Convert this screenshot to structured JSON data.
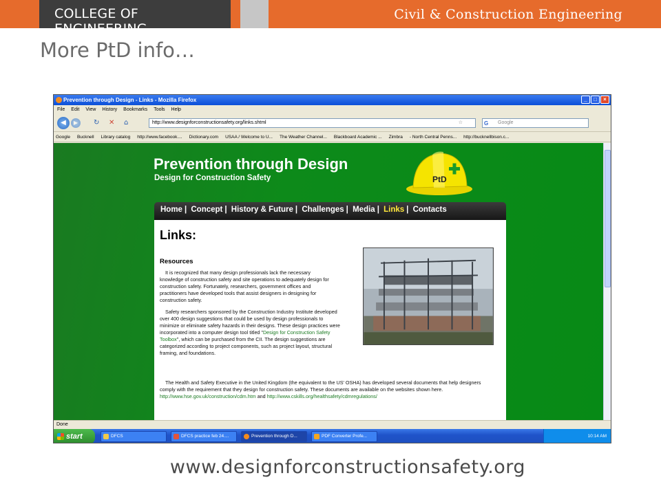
{
  "slide": {
    "banner_left": "COLLEGE OF ENGINEERING",
    "banner_right": "Civil & Construction Engineering",
    "title": "More PtD info…",
    "footer_url": "www.designforconstructionsafety.org"
  },
  "browser": {
    "window_title": "Prevention through Design - Links - Mozilla Firefox",
    "menu": [
      "File",
      "Edit",
      "View",
      "History",
      "Bookmarks",
      "Tools",
      "Help"
    ],
    "url": "http://www.designforconstructionsafety.org/links.shtml",
    "search_placeholder": "Google",
    "bookmarks": [
      "Google",
      "Bucknell",
      "Library catalog",
      "http://www.facebook....",
      "Dictionary.com",
      "USAA / Welcome to U...",
      "The Weather Channel...",
      "Blackboard Academic ...",
      "Zimbra",
      "- North Central Penns...",
      "http://bucknellbison.c..."
    ],
    "status": "Done"
  },
  "site": {
    "title": "Prevention through Design",
    "subtitle": "Design for Construction Safety",
    "helmet_label": "PtD",
    "nav": [
      "Home",
      "Concept",
      "History & Future",
      "Challenges",
      "Media",
      "Links",
      "Contacts"
    ],
    "active_nav": "Links",
    "heading": "Links:",
    "section": "Resources",
    "p1": "It is recognized that many design professionals lack the necessary knowledge of construction safety and site operations to adequately design for construction safety. Fortunately, researchers, government offices and practitioners have developed tools that assist designers in designing for construction safety.",
    "p2_a": "Safety researchers sponsored by the Construction Industry Institute developed over 400 design suggestions that could be used by design professionals to minimize or eliminate safety hazards in their designs. These design practices were incorporated into a computer design tool titled \"",
    "p2_link": "Design for Construction Safety Toolbox",
    "p2_b": "\", which can be purchased from the CII. The design suggestions are categorized according to project components, such as project layout, structural framing, and foundations.",
    "p3_a": "The Health and Safety Executive in the United Kingdom (the equivalent to the US' OSHA) has developed several documents that help designers comply with the requirement that they design for construction safety. These documents are available on the websites shown here.",
    "p3_link1": "http://www.hse.gov.uk/construction/cdm.htm",
    "p3_and": "and",
    "p3_link2": "http://www.cskills.org/healthsafety/cdmregulations/"
  },
  "taskbar": {
    "start": "start",
    "tasks": [
      "DFCS",
      "DFCS practice feb 24....",
      "Prevention through D...",
      "PDF Converter Profe..."
    ],
    "active_task": "Prevention through D...",
    "clock": "10:14 AM"
  },
  "colors": {
    "banner_orange": "#e66b2c",
    "banner_dark": "#3d3d3d",
    "site_green": "#078a16",
    "nav_active": "#ffe83a"
  }
}
